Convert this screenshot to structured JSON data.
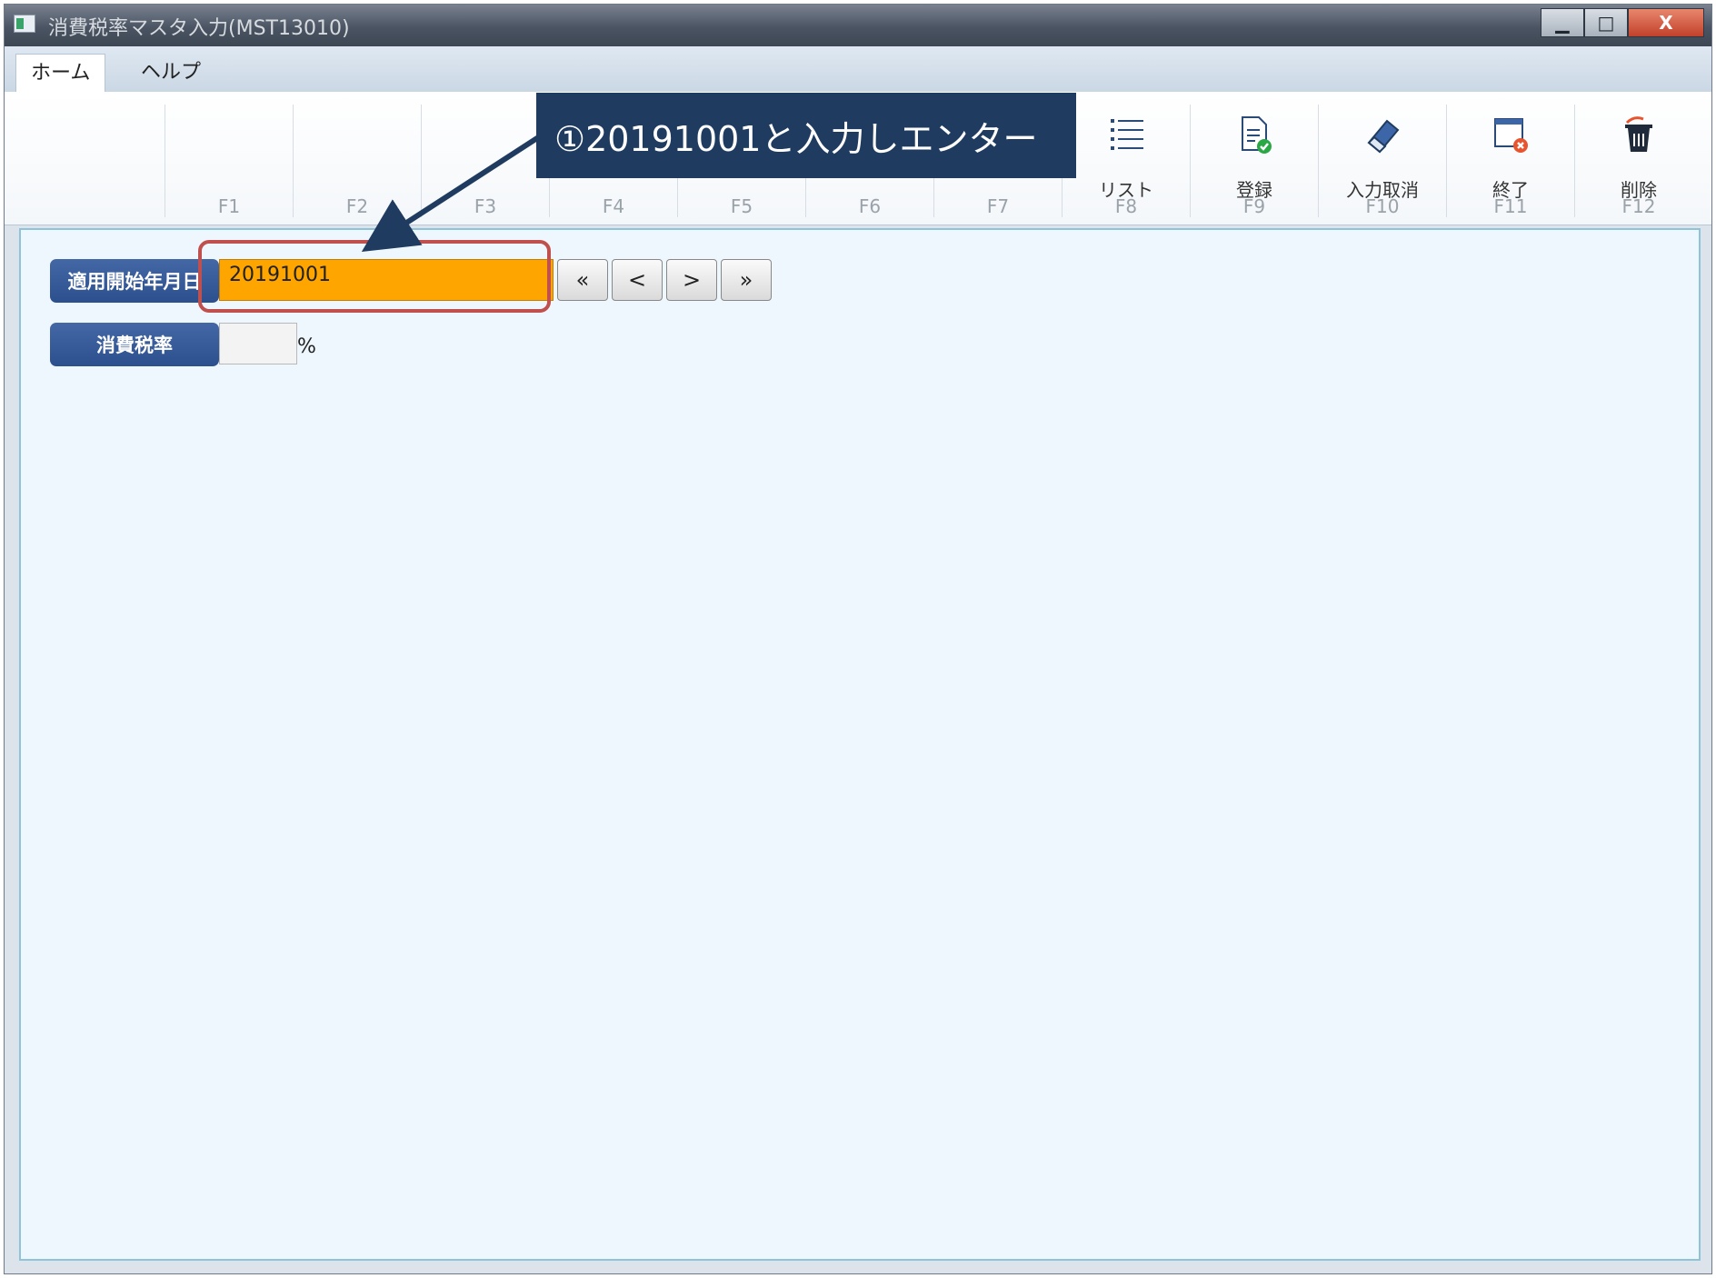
{
  "window": {
    "title": "消費税率マスタ入力(MST13010)",
    "minimize_glyph": "▁",
    "maximize_glyph": "□",
    "close_glyph": "X"
  },
  "menu_tabs": [
    {
      "label": "ホーム",
      "active": true
    },
    {
      "label": "ヘルプ",
      "active": false
    }
  ],
  "function_keys": [
    {
      "code": "F1",
      "label": ""
    },
    {
      "code": "F2",
      "label": ""
    },
    {
      "code": "F3",
      "label": ""
    },
    {
      "code": "F4",
      "label": ""
    },
    {
      "code": "F5",
      "label": ""
    },
    {
      "code": "F6",
      "label": ""
    },
    {
      "code": "F7",
      "label": ""
    },
    {
      "code": "F8",
      "label": "リスト",
      "icon": "list-icon"
    },
    {
      "code": "F9",
      "label": "登録",
      "icon": "register-document-icon"
    },
    {
      "code": "F10",
      "label": "入力取消",
      "icon": "eraser-icon"
    },
    {
      "code": "F11",
      "label": "終了",
      "icon": "exit-window-icon"
    },
    {
      "code": "F12",
      "label": "削除",
      "icon": "trash-icon"
    }
  ],
  "form": {
    "start_date_label": "適用開始年月日",
    "start_date_value": "20191001",
    "nav_first": "«",
    "nav_prev": "<",
    "nav_next": ">",
    "nav_last": "»",
    "tax_rate_label": "消費税率",
    "tax_rate_value": "",
    "tax_rate_unit": "%"
  },
  "annotation": {
    "callout_text": "①20191001と入力しエンター"
  },
  "colors": {
    "date_input_bg": "#ffa500",
    "label_bg": "#2c4f8e",
    "callout_bg": "#1f3b60",
    "highlight_border": "#c0504d",
    "content_bg": "#eef7fd"
  }
}
